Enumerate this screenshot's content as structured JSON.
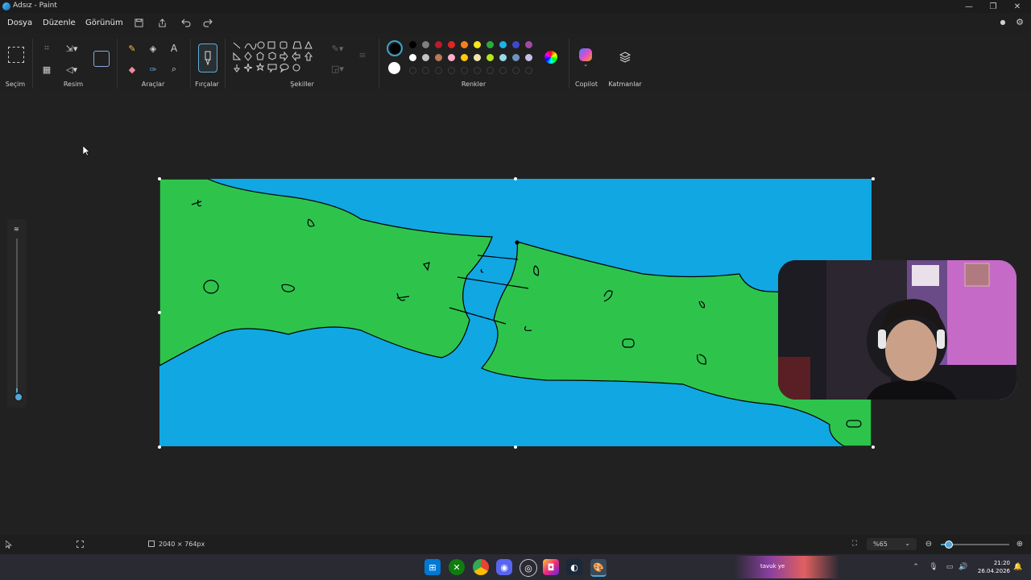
{
  "window": {
    "title": "Adsız - Paint",
    "min": "—",
    "max": "❐",
    "close": "✕"
  },
  "menu": {
    "file": "Dosya",
    "edit": "Düzenle",
    "view": "Görünüm"
  },
  "toolbar": {
    "save_icon": "save-icon",
    "share_icon": "share-icon",
    "undo_icon": "undo-icon",
    "redo_icon": "redo-icon"
  },
  "ribbon": {
    "selection_label": "Seçim",
    "image_label": "Resim",
    "tools_label": "Araçlar",
    "brushes_label": "Fırçalar",
    "shapes_label": "Şekiller",
    "colors_label": "Renkler",
    "copilot_label": "Copilot",
    "layers_label": "Katmanlar",
    "text_tool": "A"
  },
  "colors": {
    "primary": "#000000",
    "secondary": "#ffffff",
    "palette_row1": [
      "#000000",
      "#7f7f7f",
      "#b91c2c",
      "#e02424",
      "#f7801e",
      "#f9e51a",
      "#27ae3c",
      "#1fb2e6",
      "#3f48cc",
      "#a349a4"
    ],
    "palette_row2": [
      "#ffffff",
      "#c3c3c3",
      "#b97a57",
      "#ffaec9",
      "#ffc90e",
      "#efe4b0",
      "#b5e61d",
      "#99d9ea",
      "#7092be",
      "#c8bfe7"
    ],
    "land": "#2ec44c",
    "water": "#10a7e3"
  },
  "status": {
    "canvas_size": "2040 × 764px",
    "zoom": "%65"
  },
  "taskbar": {
    "time": "21:20",
    "date": "26.04.2026",
    "notification": "tavuk ye"
  }
}
